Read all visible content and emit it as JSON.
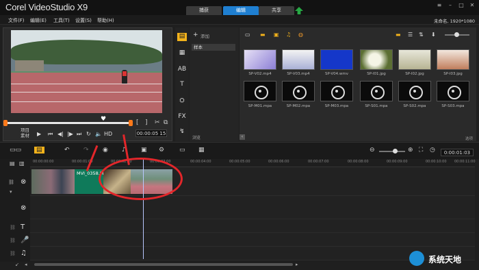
{
  "app": {
    "logo": "Corel VideoStudio X9",
    "project": "未命名, 1920*1080"
  },
  "steps": [
    {
      "label": "捕获"
    },
    {
      "label": "编辑"
    },
    {
      "label": "共享"
    }
  ],
  "menu": [
    {
      "label": "文件(F)"
    },
    {
      "label": "编辑(E)"
    },
    {
      "label": "工具(T)"
    },
    {
      "label": "设置(S)"
    },
    {
      "label": "帮助(H)"
    }
  ],
  "preview": {
    "mode_project": "项目",
    "mode_clip": "素材",
    "timecode": "00:00:05 15",
    "hd_label": "HD"
  },
  "library": {
    "add_label": "添加",
    "folder": "样本",
    "browse": "浏览",
    "items": [
      {
        "label": "SP-V02.mp4",
        "type": "video"
      },
      {
        "label": "SP-V03.mp4",
        "type": "video"
      },
      {
        "label": "SP-V04.wmv",
        "type": "video"
      },
      {
        "label": "SP-I01.jpg",
        "type": "image"
      },
      {
        "label": "SP-I02.jpg",
        "type": "image"
      },
      {
        "label": "SP-I03.jpg",
        "type": "image"
      },
      {
        "label": "SP-M01.mpa",
        "type": "audio"
      },
      {
        "label": "SP-M02.mpa",
        "type": "audio"
      },
      {
        "label": "SP-M03.mpa",
        "type": "audio"
      },
      {
        "label": "SP-S01.mpa",
        "type": "audio"
      },
      {
        "label": "SP-S02.mpa",
        "type": "audio"
      },
      {
        "label": "SP-S03.mpa",
        "type": "audio"
      }
    ]
  },
  "timeline": {
    "clock": "0:00:01:03",
    "ruler": [
      "00:00:00:00",
      "00:00:01:00",
      "00:00:02:00",
      "00:00:03:00",
      "00:00:04:00",
      "00:00:05:00",
      "00:00:06:00",
      "00:00:07:00",
      "00:00:08:00",
      "00:00:09:00",
      "00:00:10:00",
      "00:00:11:00"
    ],
    "clip_label": "MVI_0358.MP4"
  },
  "watermark": "系统天地",
  "colors": {
    "accent": "#1f7fd1",
    "annotation": "#e3262a",
    "clip": "#0f7a5a"
  }
}
